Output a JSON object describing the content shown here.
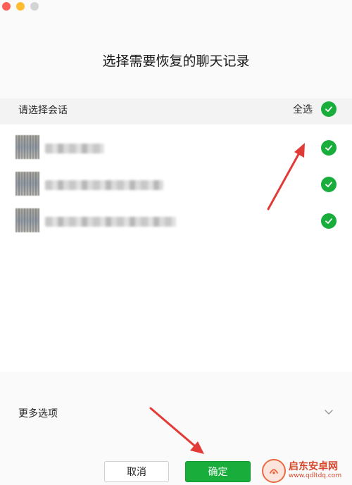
{
  "dialog": {
    "title": "选择需要恢复的聊天记录"
  },
  "section": {
    "label": "请选择会话",
    "select_all": "全选"
  },
  "conversations": [
    {
      "name": "●●●●●●",
      "selected": true
    },
    {
      "name": "●●●●●●●●●●●●●●●",
      "selected": true
    },
    {
      "name": "●●●●●●●●●●●●●●●",
      "selected": true
    }
  ],
  "more_options": {
    "label": "更多选项",
    "icon": "chevron-down-icon"
  },
  "buttons": {
    "cancel": "取消",
    "confirm": "确定"
  },
  "watermark": {
    "title": "启东安卓网",
    "url": "www.qdltdq.com"
  },
  "colors": {
    "accent_green": "#19ad3c",
    "annotation_red": "#e23a36"
  }
}
